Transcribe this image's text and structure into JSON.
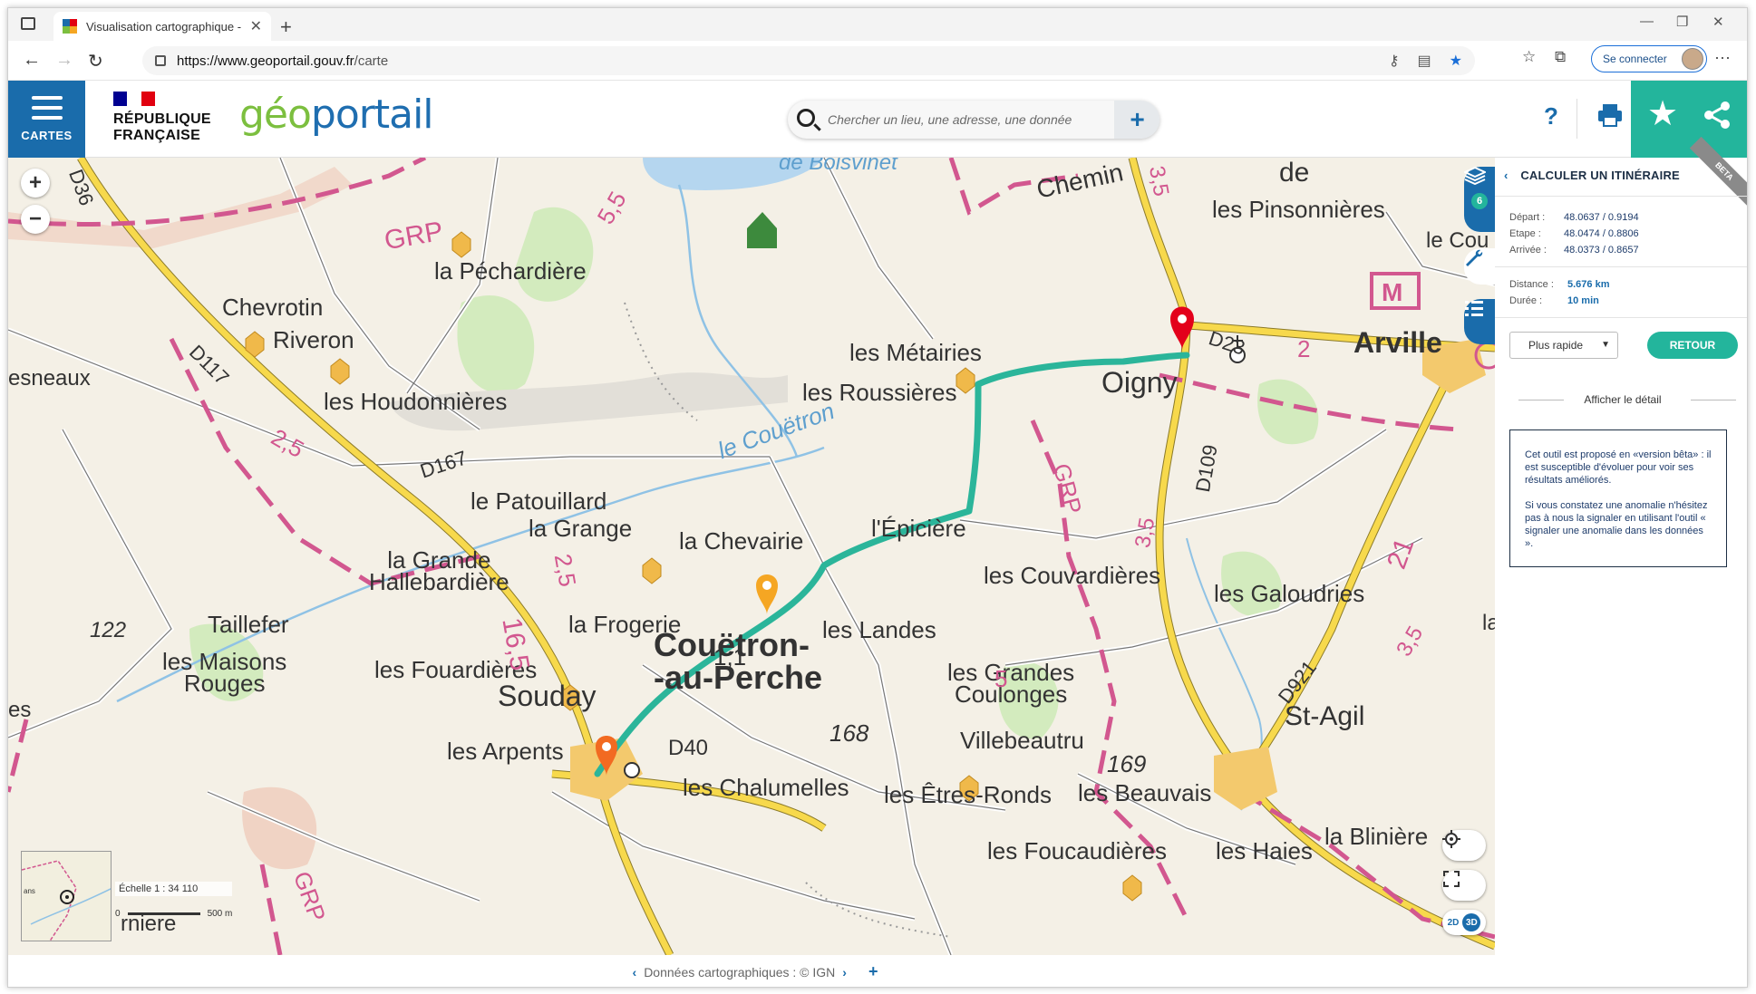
{
  "browser": {
    "tab_title": "Visualisation cartographique - G",
    "url_host": "https://www.geoportail.gouv.fr",
    "url_path": "/carte",
    "connect_label": "Se connecter"
  },
  "header": {
    "menu_label": "CARTES",
    "rf_line1": "RÉPUBLIQUE",
    "rf_line2": "FRANÇAISE",
    "logo_part1": "géo",
    "logo_part2": "portail",
    "search_placeholder": "Chercher un lieu, une adresse, une donnée",
    "help_label": "?"
  },
  "map": {
    "layers_count": "6",
    "scale_label": "Échelle 1 : 34 110",
    "scale_start": "0",
    "scale_end": "500 m",
    "mode_2d": "2D",
    "mode_3d": "3D",
    "labels": {
      "chemin": "Chemin",
      "de": "de",
      "pinsonnieres": "les Pinsonnières",
      "le_cou": "le Cou",
      "pechardiere": "la Péchardière",
      "grp1": "GRP",
      "chevrotin": "Chevrotin",
      "riveron": "Riveron",
      "esneaux": "esneaux",
      "houdonnieres": "les Houdonnières",
      "metairies": "les Métairies",
      "roussieres": "les Roussières",
      "oigny": "Oigny",
      "arville": "Arville",
      "d23": "D23",
      "d117": "D117",
      "d167": "D167",
      "couetron_river": "le Couëtron",
      "patouillard": "le Patouillard",
      "la_grange": "la Grange",
      "la_chevairie": "la Chevairie",
      "epiciere": "l'Épicière",
      "couvardieres": "les Couvardières",
      "galoudries": "les Galoudries",
      "grande_hallebardiere": "la Grande\nHallebardière",
      "taillefer": "Taillefer",
      "maisons_rouges": "les Maisons\nRouges",
      "fouardieres": "les Fouardières",
      "la_frogerie": "la Frogerie",
      "couetron_town": "Couëtron-\n-au-Perche",
      "les_landes": "les Landes",
      "grandes_coulonges": "les Grandes\nCoulonges",
      "souday": "Souday",
      "arpents": "les Arpents",
      "d40": "D40",
      "chalumelles": "les Chalumelles",
      "villebeautru": "Villebeautru",
      "etres_ronds": "les Êtres-Ronds",
      "beauvais": "les Beauvais",
      "st_agil": "St-Agil",
      "foucaudieres": "les Foucaudières",
      "les_haies": "les Haies",
      "la_bliniere": "la Blinière",
      "d921": "D921",
      "d109": "D109",
      "d36": "D36",
      "n122": "122",
      "n168": "168",
      "n169": "169",
      "n1_1": "1,1",
      "n16_5": "16,5",
      "n2_5a": "2,5",
      "n2_5b": "2,5",
      "n5_5": "5,5",
      "n3_5a": "3,5",
      "n3_5b": "3,5",
      "n3_5c": "3,5",
      "n21": "21",
      "n5": "5",
      "n2": "2",
      "grp2": "GRP",
      "grp3": "GRP",
      "grp4": "GRP",
      "rniere": "rniere",
      "ans": "ans",
      "es": "es",
      "la": "la",
      "bolsvinet": "de Boisvinet"
    }
  },
  "footer": {
    "attribution": "Données cartographiques : © IGN"
  },
  "panel": {
    "title": "CALCULER UN ITINÉRAIRE",
    "beta": "BETA",
    "depart_label": "Départ :",
    "depart_value": "48.0637 / 0.9194",
    "etape_label": "Etape :",
    "etape_value": "48.0474 / 0.8806",
    "arrivee_label": "Arrivée :",
    "arrivee_value": "48.0373 / 0.8657",
    "distance_label": "Distance :",
    "distance_value": "5.676 km",
    "duree_label": "Durée :",
    "duree_value": "10 min",
    "mode_select": "Plus rapide",
    "retour": "RETOUR",
    "detail_link": "Afficher le détail",
    "notice_p1": "Cet outil est proposé en «version bêta» : il est susceptible d'évoluer pour voir ses résultats améliorés.",
    "notice_p2": "Si vous constatez une anomalie n'hésitez pas à nous la signaler en utilisant l'outil « signaler une anomalie dans les données »."
  },
  "colors": {
    "brand_blue": "#1a6cab",
    "accent_green": "#23b59c",
    "route": "#2bb59a"
  }
}
